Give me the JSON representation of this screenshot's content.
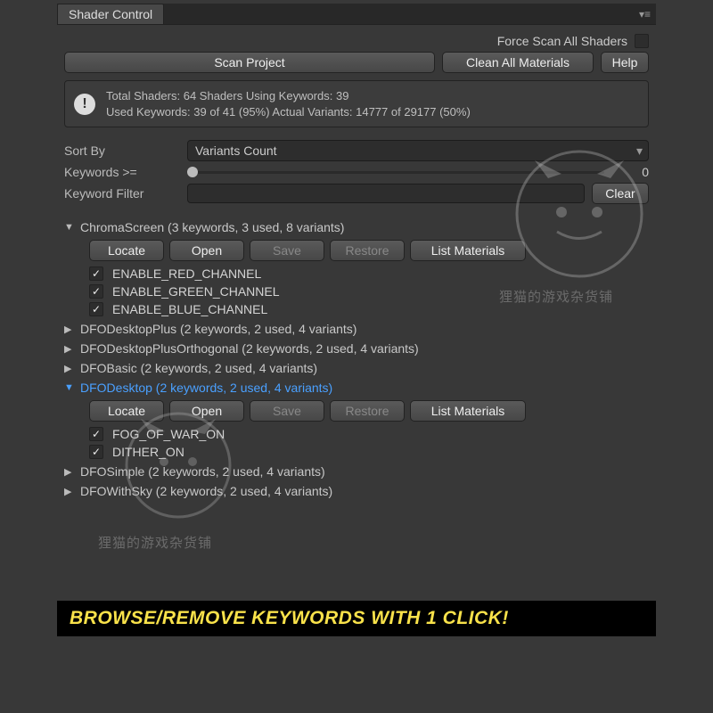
{
  "window": {
    "title": "Shader Control"
  },
  "top": {
    "force_scan_label": "Force Scan All Shaders",
    "force_scan_checked": false,
    "scan_btn": "Scan Project",
    "clean_btn": "Clean All Materials",
    "help_btn": "Help"
  },
  "info": {
    "line1": "Total Shaders: 64  Shaders Using Keywords: 39",
    "line2": "Used Keywords: 39 of 41 (95%)  Actual Variants: 14777 of 29177 (50%)"
  },
  "filters": {
    "sort_label": "Sort By",
    "sort_value": "Variants Count",
    "kw_ge_label": "Keywords >=",
    "kw_ge_value": "0",
    "kw_filter_label": "Keyword Filter",
    "kw_filter_value": "",
    "clear_btn": "Clear"
  },
  "buttons": {
    "locate": "Locate",
    "open": "Open",
    "save": "Save",
    "restore": "Restore",
    "list_materials": "List Materials"
  },
  "shaders": [
    {
      "name": "ChromaScreen",
      "summary": "(3 keywords, 3 used, 8 variants)",
      "expanded": true,
      "highlight": false,
      "keywords": [
        {
          "name": "ENABLE_RED_CHANNEL",
          "checked": true
        },
        {
          "name": "ENABLE_GREEN_CHANNEL",
          "checked": true
        },
        {
          "name": "ENABLE_BLUE_CHANNEL",
          "checked": true
        }
      ]
    },
    {
      "name": "DFODesktopPlus",
      "summary": "(2 keywords, 2 used, 4 variants)",
      "expanded": false
    },
    {
      "name": "DFODesktopPlusOrthogonal",
      "summary": "(2 keywords, 2 used, 4 variants)",
      "expanded": false
    },
    {
      "name": "DFOBasic",
      "summary": "(2 keywords, 2 used, 4 variants)",
      "expanded": false
    },
    {
      "name": "DFODesktop",
      "summary": "(2 keywords, 2 used, 4 variants)",
      "expanded": true,
      "highlight": true,
      "keywords": [
        {
          "name": "FOG_OF_WAR_ON",
          "checked": true
        },
        {
          "name": "DITHER_ON",
          "checked": true
        }
      ]
    },
    {
      "name": "DFOSimple",
      "summary": "(2 keywords, 2 used, 4 variants)",
      "expanded": false
    },
    {
      "name": "DFOWithSky",
      "summary": "(2 keywords, 2 used, 4 variants)",
      "expanded": false
    }
  ],
  "promo": "BROWSE/REMOVE KEYWORDS WITH 1 CLICK!",
  "watermark": "狸猫的游戏杂货铺"
}
